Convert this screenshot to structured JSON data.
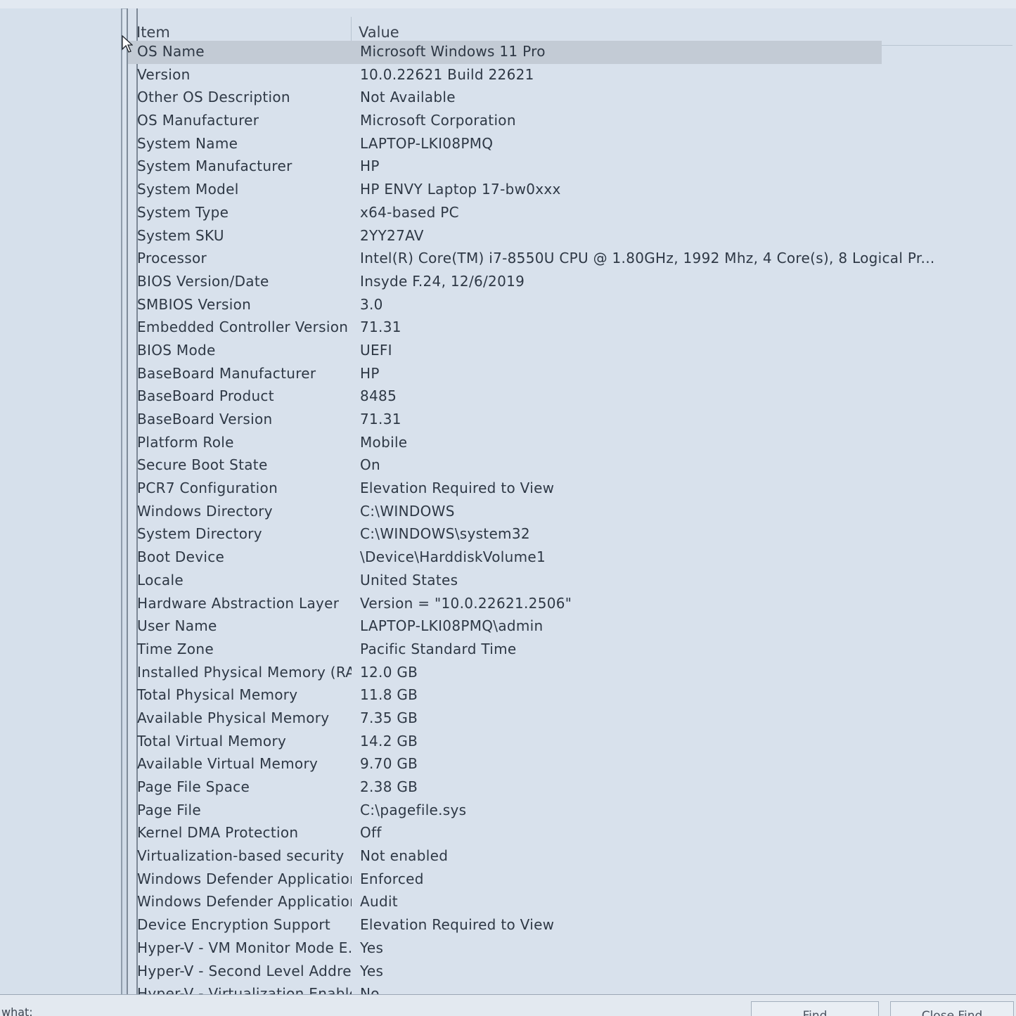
{
  "header": {
    "item_label": "Item",
    "value_label": "Value"
  },
  "rows": [
    {
      "item": "OS Name",
      "value": "Microsoft Windows 11 Pro"
    },
    {
      "item": "Version",
      "value": "10.0.22621 Build 22621"
    },
    {
      "item": "Other OS Description",
      "value": "Not Available"
    },
    {
      "item": "OS Manufacturer",
      "value": "Microsoft Corporation"
    },
    {
      "item": "System Name",
      "value": "LAPTOP-LKI08PMQ"
    },
    {
      "item": "System Manufacturer",
      "value": "HP"
    },
    {
      "item": "System Model",
      "value": "HP ENVY Laptop 17-bw0xxx"
    },
    {
      "item": "System Type",
      "value": "x64-based PC"
    },
    {
      "item": "System SKU",
      "value": "2YY27AV"
    },
    {
      "item": "Processor",
      "value": "Intel(R) Core(TM) i7-8550U CPU @ 1.80GHz, 1992 Mhz, 4 Core(s), 8 Logical Pr..."
    },
    {
      "item": "BIOS Version/Date",
      "value": "Insyde F.24, 12/6/2019"
    },
    {
      "item": "SMBIOS Version",
      "value": "3.0"
    },
    {
      "item": "Embedded Controller Version",
      "value": "71.31"
    },
    {
      "item": "BIOS Mode",
      "value": "UEFI"
    },
    {
      "item": "BaseBoard Manufacturer",
      "value": "HP"
    },
    {
      "item": "BaseBoard Product",
      "value": "8485"
    },
    {
      "item": "BaseBoard Version",
      "value": "71.31"
    },
    {
      "item": "Platform Role",
      "value": "Mobile"
    },
    {
      "item": "Secure Boot State",
      "value": "On"
    },
    {
      "item": "PCR7 Configuration",
      "value": "Elevation Required to View"
    },
    {
      "item": "Windows Directory",
      "value": "C:\\WINDOWS"
    },
    {
      "item": "System Directory",
      "value": "C:\\WINDOWS\\system32"
    },
    {
      "item": "Boot Device",
      "value": "\\Device\\HarddiskVolume1"
    },
    {
      "item": "Locale",
      "value": "United States"
    },
    {
      "item": "Hardware Abstraction Layer",
      "value": "Version = \"10.0.22621.2506\""
    },
    {
      "item": "User Name",
      "value": "LAPTOP-LKI08PMQ\\admin"
    },
    {
      "item": "Time Zone",
      "value": "Pacific Standard Time"
    },
    {
      "item": "Installed Physical Memory (RAM)",
      "value": "12.0 GB"
    },
    {
      "item": "Total Physical Memory",
      "value": "11.8 GB"
    },
    {
      "item": "Available Physical Memory",
      "value": "7.35 GB"
    },
    {
      "item": "Total Virtual Memory",
      "value": "14.2 GB"
    },
    {
      "item": "Available Virtual Memory",
      "value": "9.70 GB"
    },
    {
      "item": "Page File Space",
      "value": "2.38 GB"
    },
    {
      "item": "Page File",
      "value": "C:\\pagefile.sys"
    },
    {
      "item": "Kernel DMA Protection",
      "value": "Off"
    },
    {
      "item": "Virtualization-based security",
      "value": "Not enabled"
    },
    {
      "item": "Windows Defender Application...",
      "value": "Enforced"
    },
    {
      "item": "Windows Defender Application...",
      "value": "Audit"
    },
    {
      "item": "Device Encryption Support",
      "value": "Elevation Required to View"
    },
    {
      "item": "Hyper-V - VM Monitor Mode E...",
      "value": "Yes"
    },
    {
      "item": "Hyper-V - Second Level Addres...",
      "value": "Yes"
    },
    {
      "item": "Hyper-V - Virtualization Enable...",
      "value": "No"
    }
  ],
  "selected_row_index": 0,
  "footer": {
    "find_what_label": "what:",
    "find_button": "Find",
    "close_find_button": "Close Find"
  },
  "icons": {
    "cursor": "mouse-pointer-icon"
  }
}
